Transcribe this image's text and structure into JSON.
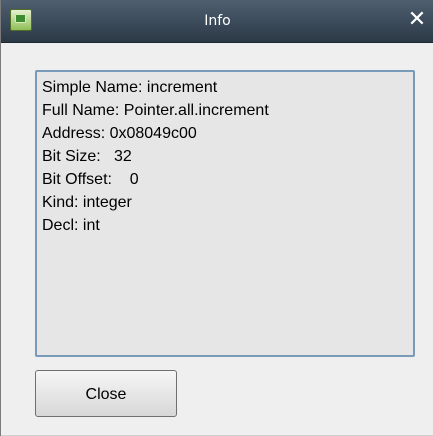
{
  "window": {
    "title": "Info",
    "close_glyph": "✕",
    "app_icon": "application-icon",
    "accent_color": "#3e4e5e"
  },
  "info": {
    "lines": [
      "Simple Name: increment",
      "Full Name: Pointer.all.increment",
      "Address: 0x08049c00",
      "Bit Size:   32",
      "Bit Offset:    0",
      "Kind: integer",
      "Decl: int"
    ]
  },
  "actions": {
    "close_label": "Close"
  }
}
